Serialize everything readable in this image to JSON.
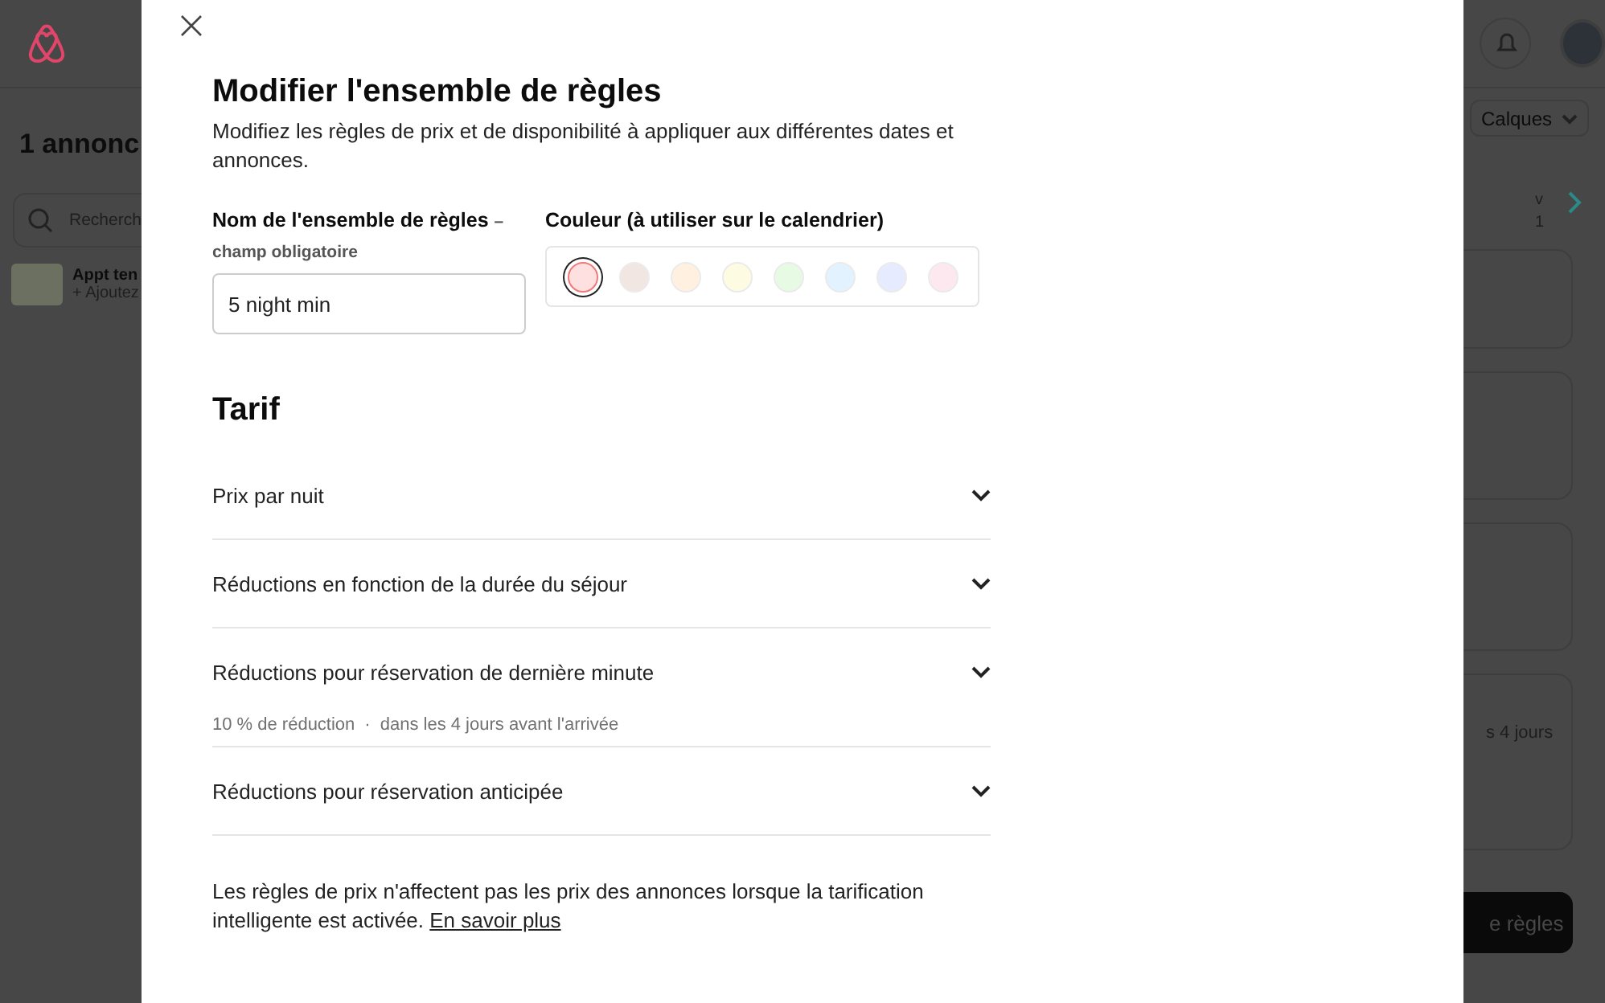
{
  "background_page": {
    "listing_count": "1 annonc",
    "search": {
      "placeholder": "Recherch"
    },
    "listing": {
      "title": "Appt ten",
      "subtitle": "+ Ajoutez"
    },
    "layers_button": "Calques",
    "date_fragment": [
      "v",
      "1"
    ],
    "card_fragment": "s 4 jours",
    "action_button": "e règles"
  },
  "dialog": {
    "title": "Modifier l'ensemble de règles",
    "subtitle": "Modifiez les règles de prix et de disponibilité à appliquer aux différentes dates et annonces.",
    "name_field": {
      "label": "Nom de l'ensemble de règles",
      "required_note": "– champ obligatoire",
      "value": "5 night min"
    },
    "color_field": {
      "label": "Couleur (à utiliser sur le calendrier)",
      "colors": [
        {
          "color": "#ffe0e0",
          "selected": true
        },
        {
          "color": "#f1e6e2",
          "selected": false
        },
        {
          "color": "#fff0e0",
          "selected": false
        },
        {
          "color": "#fdfbe2",
          "selected": false
        },
        {
          "color": "#e6fae4",
          "selected": false
        },
        {
          "color": "#e2f2ff",
          "selected": false
        },
        {
          "color": "#e6ebff",
          "selected": false
        },
        {
          "color": "#fde8ef",
          "selected": false
        }
      ]
    },
    "section_title": "Tarif",
    "sections": [
      {
        "title": "Prix par nuit"
      },
      {
        "title": "Réductions en fonction de la durée du séjour"
      },
      {
        "title": "Réductions pour réservation de dernière minute",
        "summary": [
          "10 % de réduction",
          "·",
          "dans les 4 jours avant l'arrivée"
        ]
      },
      {
        "title": "Réductions pour réservation anticipée"
      }
    ],
    "note": "Les règles de prix n'affectent pas les prix des annonces lorsque la tarification intelligente est activée.",
    "note_link": "En savoir plus"
  }
}
